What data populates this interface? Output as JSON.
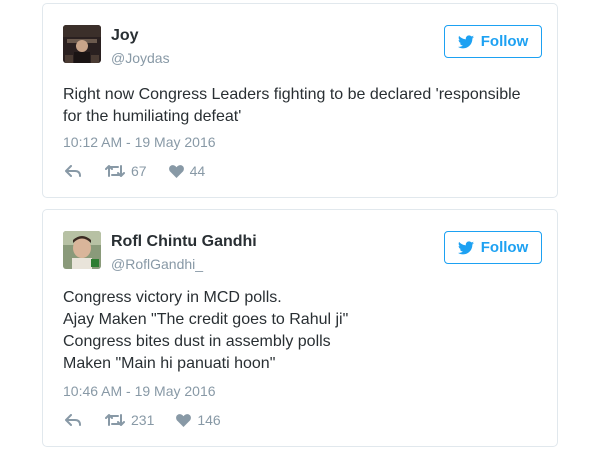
{
  "icons": {
    "follow": "twitter-bird-icon",
    "reply": "reply-arrow-icon",
    "retweet": "retweet-icon",
    "like": "heart-icon"
  },
  "colors": {
    "accent": "#1da1f2",
    "text": "#292f33",
    "muted": "#8899a6",
    "border": "#e1e8ed"
  },
  "tweets": [
    {
      "name": "Joy",
      "handle": "@Joydas",
      "follow_label": "Follow",
      "text_lines": [
        "Right now Congress Leaders fighting to be declared 'responsible",
        "for the humiliating defeat'"
      ],
      "timestamp": "10:12 AM - 19 May 2016",
      "retweets": "67",
      "likes": "44"
    },
    {
      "name": "Rofl Chintu Gandhi",
      "handle": "@RoflGandhi_",
      "follow_label": "Follow",
      "text_lines": [
        "Congress victory in MCD polls.",
        "Ajay Maken \"The credit goes to Rahul ji\"",
        "Congress bites dust in assembly polls",
        "Maken \"Main hi panuati hoon\""
      ],
      "timestamp": "10:46 AM - 19 May 2016",
      "retweets": "231",
      "likes": "146"
    }
  ]
}
